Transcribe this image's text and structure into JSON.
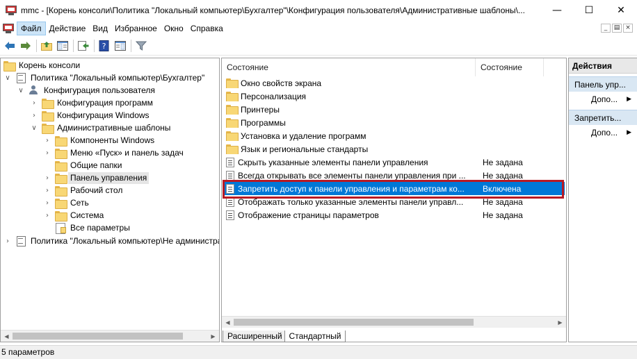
{
  "window": {
    "title": "mmc - [Корень консоли\\Политика \"Локальный компьютер\\Бухгалтер\"\\Конфигурация пользователя\\Административные шаблоны\\..."
  },
  "menu": [
    "Файл",
    "Действие",
    "Вид",
    "Избранное",
    "Окно",
    "Справка"
  ],
  "tree": {
    "items": [
      {
        "label": "Корень консоли",
        "icon": "console-root-icon",
        "expander": ""
      },
      {
        "label": "Политика \"Локальный компьютер\\Бухгалтер\"",
        "icon": "policy-icon",
        "expander": "∨"
      },
      {
        "label": "Конфигурация пользователя",
        "icon": "user-icon",
        "expander": "∨"
      },
      {
        "label": "Конфигурация программ",
        "icon": "folder-icon",
        "expander": "›"
      },
      {
        "label": "Конфигурация Windows",
        "icon": "folder-icon",
        "expander": "›"
      },
      {
        "label": "Административные шаблоны",
        "icon": "folder-icon",
        "expander": "∨"
      },
      {
        "label": "Компоненты Windows",
        "icon": "folder-icon",
        "expander": "›"
      },
      {
        "label": "Меню «Пуск» и панель задач",
        "icon": "folder-icon",
        "expander": "›"
      },
      {
        "label": "Общие папки",
        "icon": "folder-icon",
        "expander": ""
      },
      {
        "label": "Панель управления",
        "icon": "folder-icon",
        "expander": "›"
      },
      {
        "label": "Рабочий стол",
        "icon": "folder-icon",
        "expander": "›"
      },
      {
        "label": "Сеть",
        "icon": "folder-icon",
        "expander": "›"
      },
      {
        "label": "Система",
        "icon": "folder-icon",
        "expander": "›"
      },
      {
        "label": "Все параметры",
        "icon": "all-settings-icon",
        "expander": ""
      },
      {
        "label": "Политика \"Локальный компьютер\\Не администрат",
        "icon": "policy-icon",
        "expander": "›"
      }
    ]
  },
  "list": {
    "columns": [
      "Состояние",
      "Состояние"
    ],
    "rows": [
      {
        "name": "Окно свойств экрана",
        "state": "",
        "type": "folder"
      },
      {
        "name": "Персонализация",
        "state": "",
        "type": "folder"
      },
      {
        "name": "Принтеры",
        "state": "",
        "type": "folder"
      },
      {
        "name": "Программы",
        "state": "",
        "type": "folder"
      },
      {
        "name": "Установка и удаление программ",
        "state": "",
        "type": "folder"
      },
      {
        "name": "Язык и региональные стандарты",
        "state": "",
        "type": "folder"
      },
      {
        "name": "Скрыть указанные элементы панели управления",
        "state": "Не задана",
        "type": "setting"
      },
      {
        "name": "Всегда открывать все элементы панели управления при ...",
        "state": "Не задана",
        "type": "setting"
      },
      {
        "name": "Запретить доступ к панели управления и параметрам ко...",
        "state": "Включена",
        "type": "setting"
      },
      {
        "name": "Отображать только указанные элементы панели управл...",
        "state": "Не задана",
        "type": "setting"
      },
      {
        "name": "Отображение страницы параметров",
        "state": "Не задана",
        "type": "setting"
      }
    ],
    "tabs": [
      "Расширенный",
      "Стандартный"
    ]
  },
  "actions": {
    "title": "Действия",
    "sections": [
      {
        "label": "Панель упр...",
        "more": "Допо..."
      },
      {
        "label": "Запретить...",
        "more": "Допо..."
      }
    ]
  },
  "status": {
    "text": "5 параметров"
  },
  "colors": {
    "selection": "#0078d7",
    "highlight_box": "#b81a24",
    "folder": "#f8d775"
  }
}
